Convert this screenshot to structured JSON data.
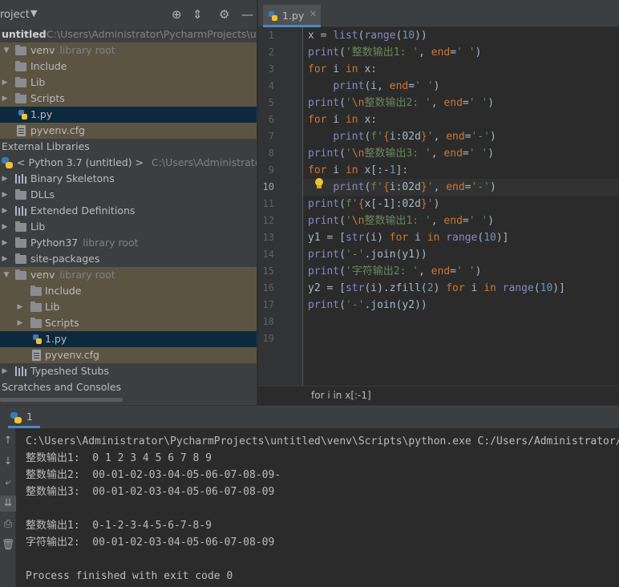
{
  "project_panel": {
    "title": "roject",
    "dropdown": "▼",
    "tree": [
      {
        "label": "untitled",
        "meta": "C:\\Users\\Administrator\\PycharmProjects\\untit"
      },
      {
        "label": "venv",
        "meta": "library root"
      },
      {
        "label": "Include",
        "meta": ""
      },
      {
        "label": "Lib",
        "meta": ""
      },
      {
        "label": "Scripts",
        "meta": ""
      },
      {
        "label": "1.py",
        "meta": ""
      },
      {
        "label": "pyvenv.cfg",
        "meta": ""
      },
      {
        "label": "External Libraries",
        "meta": ""
      },
      {
        "label": "< Python 3.7 (untitled) >",
        "meta": "C:\\Users\\Administrator\\Pyc"
      },
      {
        "label": "Binary Skeletons",
        "meta": ""
      },
      {
        "label": "DLLs",
        "meta": ""
      },
      {
        "label": "Extended Definitions",
        "meta": ""
      },
      {
        "label": "Lib",
        "meta": ""
      },
      {
        "label": "Python37",
        "meta": "library root"
      },
      {
        "label": "site-packages",
        "meta": ""
      },
      {
        "label": "venv",
        "meta": "library root"
      },
      {
        "label": "Include",
        "meta": ""
      },
      {
        "label": "Lib",
        "meta": ""
      },
      {
        "label": "Scripts",
        "meta": ""
      },
      {
        "label": "1.py",
        "meta": ""
      },
      {
        "label": "pyvenv.cfg",
        "meta": ""
      },
      {
        "label": "Typeshed Stubs",
        "meta": ""
      },
      {
        "label": "Scratches and Consoles",
        "meta": ""
      }
    ]
  },
  "editor": {
    "tab_label": "1.py",
    "tab_close": "✕",
    "line_numbers": [
      "1",
      "2",
      "3",
      "4",
      "5",
      "6",
      "7",
      "8",
      "9",
      "10",
      "11",
      "12",
      "13",
      "14",
      "15",
      "16",
      "17",
      "18",
      "19"
    ],
    "current_line": "10",
    "lines": [
      "x = list(range(10))",
      "print('整数输出1: ', end=' ')",
      "for i in x:",
      "    print(i, end=' ')",
      "print('\\n整数输出2: ', end=' ')",
      "for i in x:",
      "    print(f'{i:02d}', end='-')",
      "print('\\n整数输出3: ', end=' ')",
      "for i in x[:-1]:",
      "    print(f'{i:02d}', end='-')",
      "print(f'{x[-1]:02d}')",
      "print('\\n整数输出1: ', end=' ')",
      "y1 = [str(i) for i in range(10)]",
      "print('-'.join(y1))",
      "print('字符输出2: ', end=' ')",
      "y2 = [str(i).zfill(2) for i in range(10)]",
      "print('-'.join(y2))",
      "",
      ""
    ],
    "breadcrumb": "for i in x[:-1]"
  },
  "run_panel": {
    "tab_label": "1",
    "output": [
      "C:\\Users\\Administrator\\PycharmProjects\\untitled\\venv\\Scripts\\python.exe C:/Users/Administrator/",
      "整数输出1:  0 1 2 3 4 5 6 7 8 9",
      "整数输出2:  00-01-02-03-04-05-06-07-08-09-",
      "整数输出3:  00-01-02-03-04-05-06-07-08-09",
      "",
      "整数输出1:  0-1-2-3-4-5-6-7-8-9",
      "字符输出2:  00-01-02-03-04-05-06-07-08-09",
      "",
      "Process finished with exit code 0"
    ]
  },
  "colors": {
    "keyword": "#cc7832",
    "builtin": "#8888c6",
    "string": "#6a8759",
    "number": "#6897bb",
    "selection": "#0d293e",
    "highlight_row": "#5c5443",
    "tab_accent": "#4a88c7"
  },
  "icons": {
    "header": [
      "crosshair-icon",
      "collapse-icon",
      "gear-icon",
      "minimize-icon"
    ],
    "run_toolbar": [
      "arrow-up-icon",
      "arrow-down-icon",
      "soft-wrap-icon",
      "scroll-to-end-icon",
      "print-icon",
      "trash-icon"
    ]
  }
}
